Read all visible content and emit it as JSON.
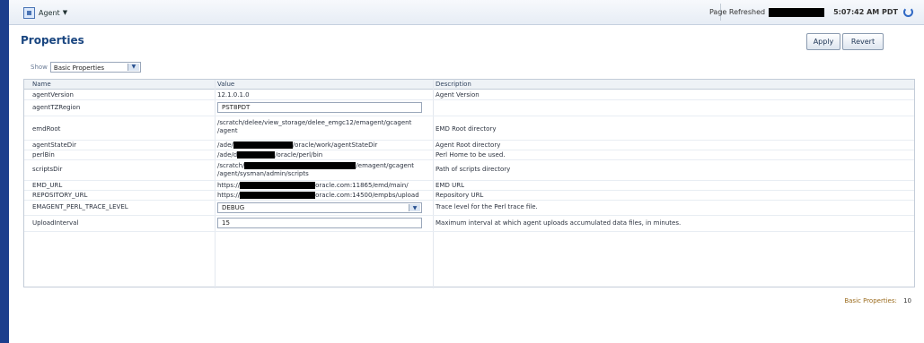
{
  "header": {
    "agent_menu": "Agent",
    "page_refreshed_label": "Page Refreshed",
    "refresh_time": "5:07:42 AM PDT"
  },
  "page": {
    "title": "Properties",
    "apply": "Apply",
    "revert": "Revert"
  },
  "filter": {
    "show_label": "Show",
    "selected": "Basic Properties"
  },
  "table": {
    "headers": {
      "name": "Name",
      "value": "Value",
      "description": "Description"
    },
    "rows": [
      {
        "name": "agentVersion",
        "value": "12.1.0.1.0",
        "description": "Agent Version"
      },
      {
        "name": "agentTZRegion",
        "value": "PST8PDT",
        "description": ""
      },
      {
        "name": "emdRoot",
        "value": "/scratch/delee/view_storage/delee_emgc12/emagent/gcagent\n/agent",
        "description": "EMD Root directory"
      },
      {
        "name": "agentStateDir",
        "value_prefix": "/ade/",
        "value_suffix": "/oracle/work/agentStateDir",
        "description": "Agent Root directory"
      },
      {
        "name": "perlBin",
        "value_prefix": "/ade/d",
        "value_suffix": "/oracle/perl/bin",
        "description": "Perl Home to be used."
      },
      {
        "name": "scriptsDir",
        "value_prefix": "/scratch/",
        "value_suffix": "/emagent/gcagent\n/agent/sysman/admin/scripts",
        "description": "Path of scripts directory"
      },
      {
        "name": "EMD_URL",
        "value_prefix": "https://",
        "value_suffix": "oracle.com:11865/emd/main/",
        "description": "EMD URL"
      },
      {
        "name": "REPOSITORY_URL",
        "value_prefix": "https://",
        "value_suffix": "oracle.com:14500/empbs/upload",
        "description": "Repository URL"
      },
      {
        "name": "EMAGENT_PERL_TRACE_LEVEL",
        "value": "DEBUG",
        "description": "Trace level for the Perl trace file."
      },
      {
        "name": "UploadInterval",
        "value": "15",
        "description": "Maximum interval at which agent uploads accumulated data files, in minutes."
      }
    ]
  },
  "footer": {
    "label": "Basic Properties:",
    "count": "10"
  }
}
